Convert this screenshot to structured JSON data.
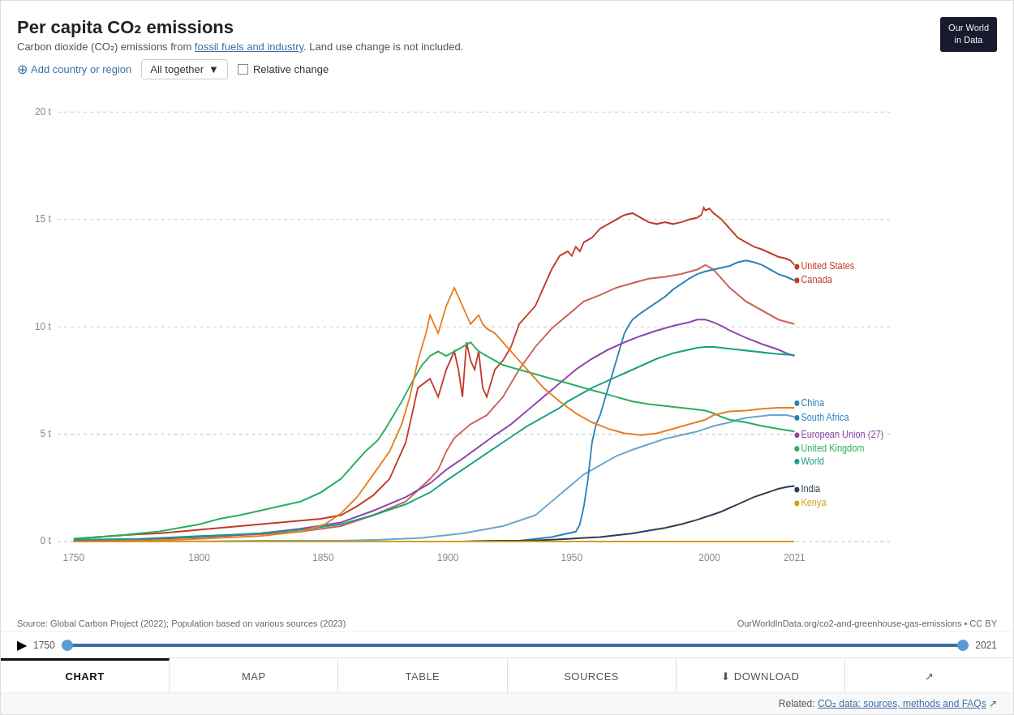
{
  "header": {
    "title": "Per capita CO₂ emissions",
    "subtitle_pre": "Carbon dioxide (CO₂) emissions from ",
    "subtitle_link": "fossil fuels and industry",
    "subtitle_post": ". Land use change is not included.",
    "owid_line1": "Our World",
    "owid_line2": "in Data"
  },
  "controls": {
    "add_country_label": "Add country or region",
    "dropdown_label": "All together",
    "relative_change_label": "Relative change"
  },
  "y_axis": {
    "labels": [
      "20 t",
      "15 t",
      "10 t",
      "5 t",
      "0 t"
    ]
  },
  "x_axis": {
    "labels": [
      "1750",
      "1800",
      "1850",
      "1900",
      "1950",
      "2000",
      "2021"
    ]
  },
  "series": [
    {
      "name": "United States",
      "color": "#c0392b"
    },
    {
      "name": "Canada",
      "color": "#c0392b"
    },
    {
      "name": "China",
      "color": "#2980b9"
    },
    {
      "name": "South Africa",
      "color": "#2980b9"
    },
    {
      "name": "European Union (27)",
      "color": "#8e44ad"
    },
    {
      "name": "United Kingdom",
      "color": "#27ae60"
    },
    {
      "name": "World",
      "color": "#16a085"
    },
    {
      "name": "India",
      "color": "#2c3e50"
    },
    {
      "name": "Kenya",
      "color": "#d4a017"
    }
  ],
  "source": {
    "text": "Source: Global Carbon Project (2022); Population based on various sources (2023)",
    "url_text": "OurWorldInData.org/co2-and-greenhouse-gas-emissions • CC BY"
  },
  "timeline": {
    "start_year": "1750",
    "end_year": "2021"
  },
  "tabs": [
    {
      "id": "chart",
      "label": "CHART",
      "active": true
    },
    {
      "id": "map",
      "label": "MAP",
      "active": false
    },
    {
      "id": "table",
      "label": "TABLE",
      "active": false
    },
    {
      "id": "sources",
      "label": "SOURCES",
      "active": false
    },
    {
      "id": "download",
      "label": "⬇ DOWNLOAD",
      "active": false
    },
    {
      "id": "share",
      "label": "share",
      "active": false
    }
  ],
  "related": {
    "pre": "Related: ",
    "link_text": "CO₂ data: sources, methods and FAQs",
    "link_url": "#"
  }
}
